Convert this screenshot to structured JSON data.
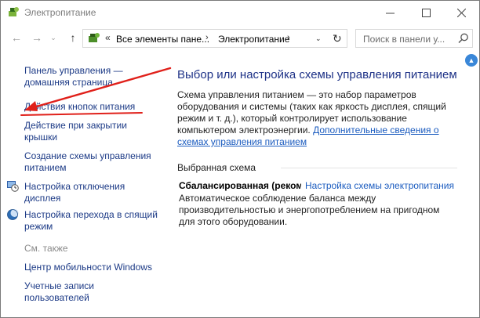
{
  "window": {
    "title": "Электропитание",
    "controls": {
      "minimize": "—",
      "maximize": "☐",
      "close": "✕"
    }
  },
  "nav": {
    "back_icon": "←",
    "forward_icon": "→",
    "history_icon": "⌄",
    "up_icon": "↑",
    "address": {
      "chevron": "«",
      "segment1": "Все элементы пане...",
      "separator": "›",
      "segment2": "Электропитание",
      "dropdown": "⌄",
      "refresh": "↻"
    },
    "search_placeholder": "Поиск в панели у..."
  },
  "sidebar": {
    "items": [
      {
        "label": "Панель управления — домашняя страница"
      },
      {
        "label": "Действия кнопок питания"
      },
      {
        "label": "Действие при закрытии крышки"
      },
      {
        "label": "Создание схемы управления питанием"
      },
      {
        "label": "Настройка отключения дисплея"
      },
      {
        "label": "Настройка перехода в спящий режим"
      }
    ],
    "see_also_title": "См. также",
    "see_also": [
      {
        "label": "Центр мобильности Windows"
      },
      {
        "label": "Учетные записи пользователей"
      }
    ]
  },
  "main": {
    "title": "Выбор или настройка схемы управления питанием",
    "description": "Схема управления питанием — это набор параметров оборудования и системы (таких как яркость дисплея, спящий режим и т. д.), который контролирует использование компьютером электроэнергии. ",
    "more_link": "Дополнительные сведения о схемах управления питанием",
    "section_title": "Выбранная схема",
    "plan_name": "Сбалансированная (рекомендуется)",
    "plan_link": "Настройка схемы электропитания",
    "plan_description": "Автоматическое соблюдение баланса между производительностью и энергопотреблением на пригодном для этого оборудовании."
  },
  "scrollbar": {
    "up_arrow": "▲"
  },
  "colors": {
    "link": "#1c3a86",
    "title": "#1e3287",
    "accent_link": "#1a5bbf",
    "annotation": "#e0201a"
  }
}
